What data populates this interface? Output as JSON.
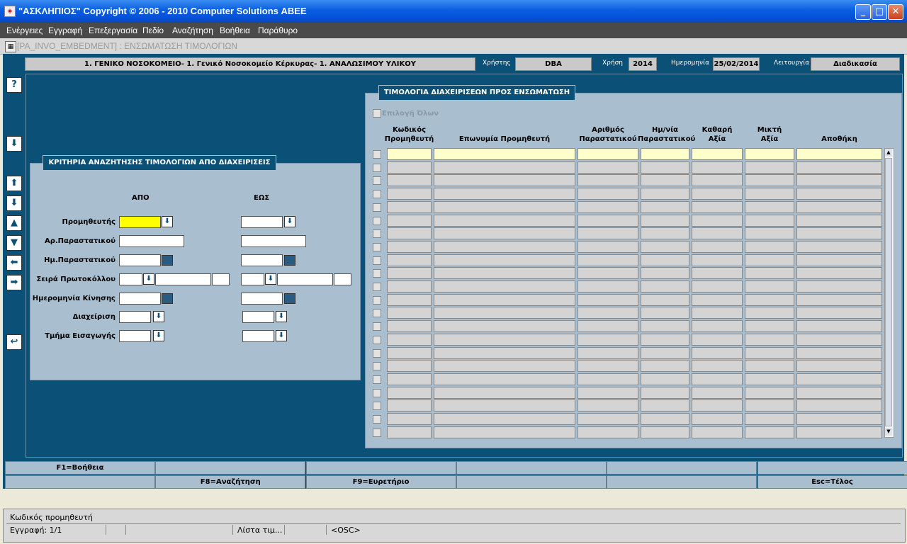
{
  "window": {
    "title": "\"ΑΣΚΛΗΠΙΟΣ\" Copyright © 2006 - 2010 Computer Solutions ΑΒΕΕ"
  },
  "menu": [
    "Ενέργειες",
    "Εγγραφή",
    "Επεξεργασία",
    "Πεδίο",
    "Αναζήτηση",
    "Βοήθεια",
    "Παράθυρο"
  ],
  "form": {
    "title": "[PA_INVO_EMBEDMENT]  :  ΕΝΣΩΜΑΤΩΣΗ ΤΙΜΟΛΟΓΙΩΝ"
  },
  "header": {
    "org": "1. ΓΕΝΙΚΟ ΝΟΣΟΚΟΜΕΙΟ- 1. Γενικό Νοσοκομείο Κέρκυρας- 1. ΑΝΑΛΩΣΙΜΟΥ ΥΛΙΚΟΥ",
    "user_label": "Χρήστης",
    "user": "DBA",
    "year_label": "Χρήση",
    "year": "2014",
    "date_label": "Ημερομηνία",
    "date": "25/02/2014",
    "mode_label": "Λειτουργία",
    "mode": "Διαδικασία"
  },
  "side_buttons": {
    "help": "?",
    "down": "⬇",
    "up2": "⬆",
    "down2": "⬇",
    "prev": "▲",
    "next": "▼",
    "left": "⬅",
    "right": "➡",
    "back": "↩"
  },
  "criteria": {
    "title": "ΚΡΙΤΗΡΙΑ ΑΝΑΖΗΤΗΣΗΣ ΤΙΜΟΛΟΓΙΩΝ ΑΠΟ ΔΙΑΧΕΙΡΙΣΕΙΣ",
    "from": "ΑΠΟ",
    "to": "ΕΩΣ",
    "labels": {
      "supplier": "Προμηθευτής",
      "doc_no": "Αρ.Παραστατικού",
      "doc_date": "Ημ.Παραστατικού",
      "protocol": "Σειρά Πρωτοκόλλου",
      "move_date": "Ημερομηνία Κίνησης",
      "management": "Διαχείριση",
      "import_dept": "Τμήμα Εισαγωγής"
    }
  },
  "invoices": {
    "title": "ΤΙΜΟΛΟΓΙΑ ΔΙΑΧΕΙΡΙΣΕΩΝ ΠΡΟΣ ΕΝΣΩΜΑΤΩΣΗ",
    "select_all": "Επιλογή Όλων",
    "columns": [
      {
        "l1": "Κωδικός",
        "l2": "Προμηθευτή"
      },
      {
        "l1": "",
        "l2": "Επωνυμία Προμηθευτή"
      },
      {
        "l1": "Αριθμός",
        "l2": "Παραστατικού"
      },
      {
        "l1": "Ημ/νία",
        "l2": "Παραστατικού"
      },
      {
        "l1": "Καθαρή",
        "l2": "Αξία"
      },
      {
        "l1": "Μικτή",
        "l2": "Αξία"
      },
      {
        "l1": "",
        "l2": "Αποθήκη"
      }
    ],
    "row_count": 22
  },
  "fkeys": {
    "row1": [
      "F1=Βοήθεια",
      "",
      "",
      "",
      "",
      ""
    ],
    "row2": [
      "",
      "F8=Αναζήτηση",
      "F9=Ευρετήριο",
      "",
      "",
      "Esc=Τέλος"
    ]
  },
  "status": {
    "message": "Κωδικός προμηθευτή",
    "record": "Εγγραφή: 1/1",
    "list": "Λίστα τιμ...",
    "osc": "<OSC>"
  }
}
